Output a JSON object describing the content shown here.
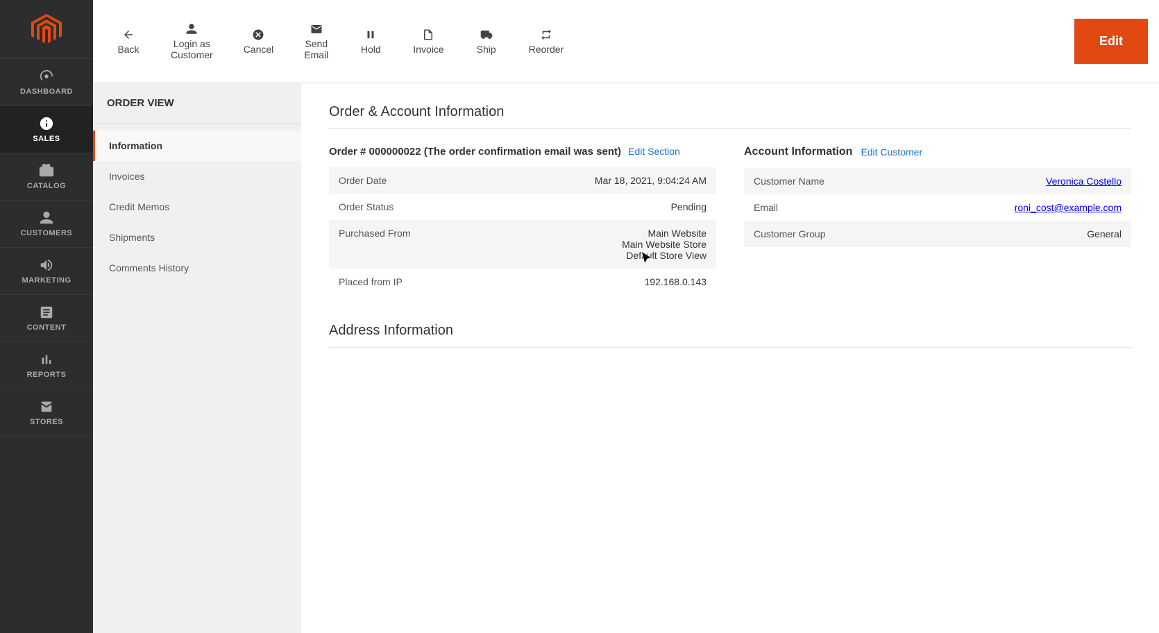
{
  "sidebar": {
    "logo_color": "#e04a11",
    "items": [
      {
        "id": "dashboard",
        "label": "DASHBOARD",
        "icon": "dashboard-icon"
      },
      {
        "id": "sales",
        "label": "SALES",
        "icon": "sales-icon",
        "active": true
      },
      {
        "id": "catalog",
        "label": "CATALOG",
        "icon": "catalog-icon"
      },
      {
        "id": "customers",
        "label": "CUSTOMERS",
        "icon": "customers-icon"
      },
      {
        "id": "marketing",
        "label": "MARKETING",
        "icon": "marketing-icon"
      },
      {
        "id": "content",
        "label": "CONTENT",
        "icon": "content-icon"
      },
      {
        "id": "reports",
        "label": "REPORTS",
        "icon": "reports-icon"
      },
      {
        "id": "stores",
        "label": "STORES",
        "icon": "stores-icon"
      }
    ]
  },
  "toolbar": {
    "back_label": "Back",
    "login_as_customer_label": "Login as\nCustomer",
    "cancel_label": "Cancel",
    "send_email_label": "Send\nEmail",
    "hold_label": "Hold",
    "invoice_label": "Invoice",
    "ship_label": "Ship",
    "reorder_label": "Reorder",
    "edit_label": "Edit"
  },
  "left_panel": {
    "title": "ORDER VIEW",
    "items": [
      {
        "id": "information",
        "label": "Information",
        "active": true
      },
      {
        "id": "invoices",
        "label": "Invoices"
      },
      {
        "id": "credit_memos",
        "label": "Credit Memos"
      },
      {
        "id": "shipments",
        "label": "Shipments"
      },
      {
        "id": "comments_history",
        "label": "Comments History"
      }
    ]
  },
  "main": {
    "section_title": "Order & Account Information",
    "order": {
      "heading": "Order # 000000022 (The order confirmation email was sent)",
      "edit_section_label": "Edit Section",
      "fields": [
        {
          "label": "Order Date",
          "value": "Mar 18, 2021, 9:04:24 AM"
        },
        {
          "label": "Order Status",
          "value": "Pending"
        },
        {
          "label": "Purchased From",
          "value": "Main Website\nMain Website Store\nDefault Store View"
        },
        {
          "label": "Placed from IP",
          "value": "192.168.0.143"
        }
      ]
    },
    "account": {
      "heading": "Account Information",
      "edit_customer_label": "Edit Customer",
      "fields": [
        {
          "label": "Customer Name",
          "value": "Veronica Costello",
          "link": true
        },
        {
          "label": "Email",
          "value": "roni_cost@example.com",
          "link": true
        },
        {
          "label": "Customer Group",
          "value": "General",
          "link": false
        }
      ]
    },
    "address_section_title": "Address Information"
  }
}
